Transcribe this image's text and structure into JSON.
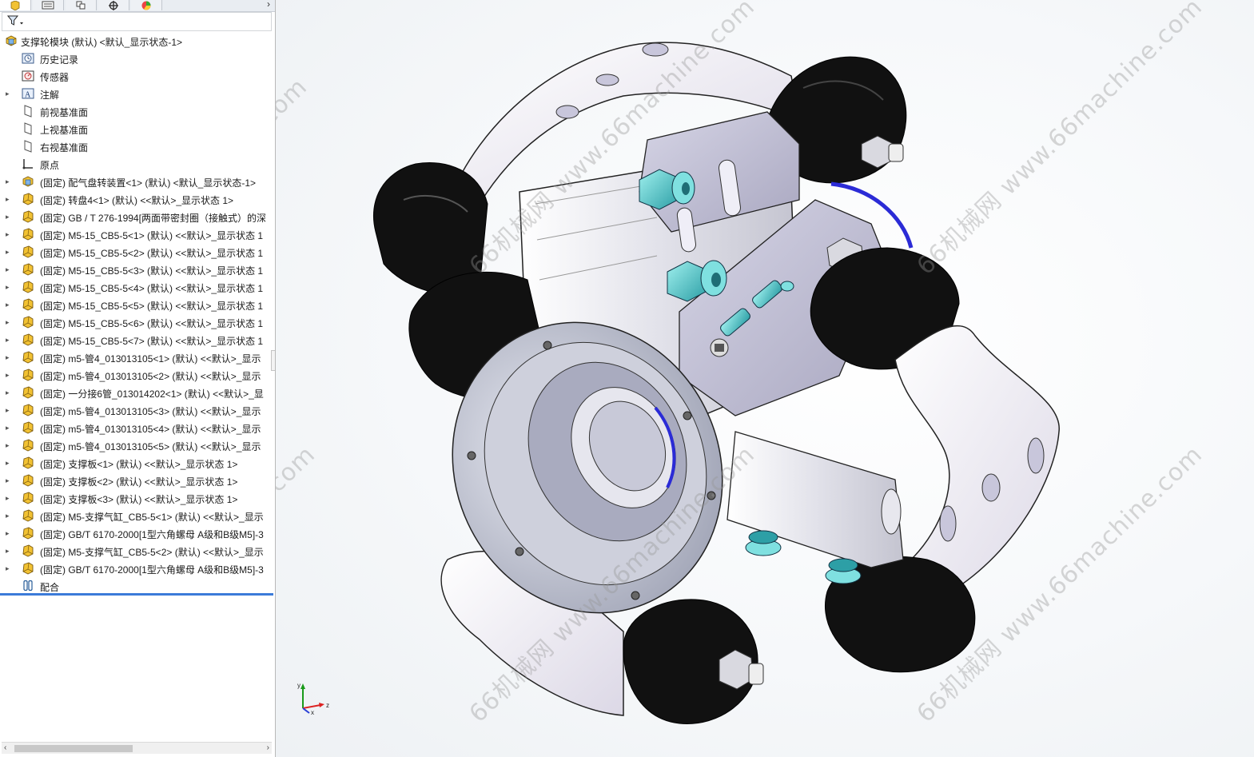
{
  "feature_tree": {
    "root_label": "支撑轮模块 (默认) <默认_显示状态-1>",
    "items": [
      {
        "label": "历史记录",
        "icon": "history-icon",
        "expandable": false
      },
      {
        "label": "传感器",
        "icon": "sensor-icon",
        "expandable": false
      },
      {
        "label": "注解",
        "icon": "annotation-icon",
        "expandable": true
      },
      {
        "label": "前视基准面",
        "icon": "plane-icon",
        "expandable": false
      },
      {
        "label": "上视基准面",
        "icon": "plane-icon",
        "expandable": false
      },
      {
        "label": "右视基准面",
        "icon": "plane-icon",
        "expandable": false
      },
      {
        "label": "原点",
        "icon": "origin-icon",
        "expandable": false
      },
      {
        "label": "(固定) 配气盘转装置<1> (默认) <默认_显示状态-1>",
        "icon": "subassembly-icon",
        "expandable": true
      },
      {
        "label": "(固定) 转盘4<1> (默认) <<默认>_显示状态 1>",
        "icon": "part-icon",
        "expandable": true
      },
      {
        "label": "(固定) GB / T 276-1994[两面带密封圈（接触式）的深",
        "icon": "part-icon",
        "expandable": true
      },
      {
        "label": "(固定) M5-15_CB5-5<1> (默认) <<默认>_显示状态 1",
        "icon": "part-icon",
        "expandable": true
      },
      {
        "label": "(固定) M5-15_CB5-5<2> (默认) <<默认>_显示状态 1",
        "icon": "part-icon",
        "expandable": true
      },
      {
        "label": "(固定) M5-15_CB5-5<3> (默认) <<默认>_显示状态 1",
        "icon": "part-icon",
        "expandable": true
      },
      {
        "label": "(固定) M5-15_CB5-5<4> (默认) <<默认>_显示状态 1",
        "icon": "part-icon",
        "expandable": true
      },
      {
        "label": "(固定) M5-15_CB5-5<5> (默认) <<默认>_显示状态 1",
        "icon": "part-icon",
        "expandable": true
      },
      {
        "label": "(固定) M5-15_CB5-5<6> (默认) <<默认>_显示状态 1",
        "icon": "part-icon",
        "expandable": true
      },
      {
        "label": "(固定) M5-15_CB5-5<7> (默认) <<默认>_显示状态 1",
        "icon": "part-icon",
        "expandable": true
      },
      {
        "label": "(固定) m5-管4_013013105<1> (默认) <<默认>_显示",
        "icon": "part-icon",
        "expandable": true
      },
      {
        "label": "(固定) m5-管4_013013105<2> (默认) <<默认>_显示",
        "icon": "part-icon",
        "expandable": true
      },
      {
        "label": "(固定) 一分接6管_013014202<1> (默认) <<默认>_显",
        "icon": "part-icon",
        "expandable": true
      },
      {
        "label": "(固定) m5-管4_013013105<3> (默认) <<默认>_显示",
        "icon": "part-icon",
        "expandable": true
      },
      {
        "label": "(固定) m5-管4_013013105<4> (默认) <<默认>_显示",
        "icon": "part-icon",
        "expandable": true
      },
      {
        "label": "(固定) m5-管4_013013105<5> (默认) <<默认>_显示",
        "icon": "part-icon",
        "expandable": true
      },
      {
        "label": "(固定) 支撑板<1> (默认) <<默认>_显示状态 1>",
        "icon": "part-icon",
        "expandable": true
      },
      {
        "label": "(固定) 支撑板<2> (默认) <<默认>_显示状态 1>",
        "icon": "part-icon",
        "expandable": true
      },
      {
        "label": "(固定) 支撑板<3> (默认) <<默认>_显示状态 1>",
        "icon": "part-icon",
        "expandable": true
      },
      {
        "label": "(固定) M5-支撑气缸_CB5-5<1> (默认) <<默认>_显示",
        "icon": "part-icon",
        "expandable": true
      },
      {
        "label": "(固定) GB/T 6170-2000[1型六角螺母 A级和B级M5]-3",
        "icon": "part-icon",
        "expandable": true
      },
      {
        "label": "(固定) M5-支撑气缸_CB5-5<2> (默认) <<默认>_显示",
        "icon": "part-icon",
        "expandable": true
      },
      {
        "label": "(固定) GB/T 6170-2000[1型六角螺母 A级和B级M5]-3",
        "icon": "part-icon",
        "expandable": true
      },
      {
        "label": "配合",
        "icon": "mates-icon",
        "expandable": false
      }
    ]
  },
  "watermark": {
    "cn": "66机械网",
    "url": "www.66machine.com"
  },
  "triad": {
    "x": "x",
    "y": "y",
    "z": "z"
  },
  "colors": {
    "tree_divider": "#3b7bd9",
    "part_icon": "#f2c233",
    "wheel": "#101010",
    "bracket": "#ece9f3",
    "fitting": "#4fc8c8",
    "flange": "#b8bccb",
    "oring": "#2b2bd6"
  }
}
